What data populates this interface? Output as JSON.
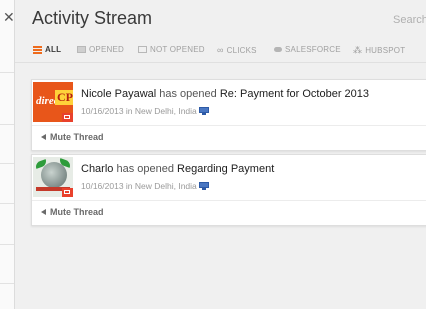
{
  "header": {
    "title": "Activity Stream",
    "search_placeholder": "Search"
  },
  "filters": [
    {
      "label": "ALL",
      "icon": "hamburger-icon",
      "active": true
    },
    {
      "label": "OPENED",
      "icon": "envelope-filled-icon",
      "active": false
    },
    {
      "label": "NOT OPENED",
      "icon": "envelope-outline-icon",
      "active": false
    },
    {
      "label": "CLICKS",
      "icon": "link-icon",
      "active": false
    },
    {
      "label": "SALESFORCE",
      "icon": "cloud-icon",
      "active": false
    },
    {
      "label": "HUBSPOT",
      "icon": "sprocket-icon",
      "active": false
    }
  ],
  "activities": [
    {
      "name": "Nicole Payawal",
      "action": "has opened",
      "subject": "Re: Payment for October 2013",
      "meta": "10/16/2013 in New Delhi, India",
      "device_icon": "desktop-icon",
      "mute_label": "Mute Thread",
      "avatar_text": [
        "direct",
        "CPV"
      ]
    },
    {
      "name": "Charlo",
      "action": "has opened",
      "subject": "Regarding Payment",
      "meta": "10/16/2013 in New Delhi, India",
      "device_icon": "desktop-icon",
      "mute_label": "Mute Thread"
    }
  ],
  "colors": {
    "accent": "#ee6b1c",
    "background": "#f0f0f0",
    "card": "#ffffff",
    "badge": "#e9412c",
    "device": "#4a77c2"
  }
}
